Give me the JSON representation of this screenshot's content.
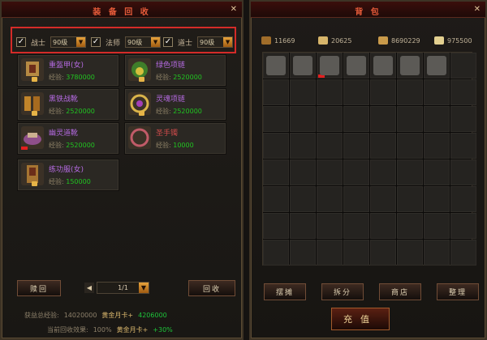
{
  "left_panel": {
    "title": "装 备 回 收",
    "close": "✕",
    "filters": [
      {
        "label": "战士",
        "level": "90级",
        "checked": "✓"
      },
      {
        "label": "法师",
        "level": "90级",
        "checked": "✓"
      },
      {
        "label": "道士",
        "level": "90级",
        "checked": "✓"
      }
    ],
    "exp_label": "经验:",
    "items": [
      {
        "name": "重盔甲(女)",
        "exp": "3780000",
        "name_color": "#b46ae0"
      },
      {
        "name": "绿色项链",
        "exp": "2520000",
        "name_color": "#b46ae0"
      },
      {
        "name": "黑铁战靴",
        "exp": "2520000",
        "name_color": "#b46ae0"
      },
      {
        "name": "灵魂项链",
        "exp": "2520000",
        "name_color": "#b46ae0"
      },
      {
        "name": "幽灵道靴",
        "exp": "2520000",
        "name_color": "#b46ae0"
      },
      {
        "name": "圣手镯",
        "exp": "10000",
        "name_color": "#d04b4b"
      },
      {
        "name": "练功服(女)",
        "exp": "150000",
        "name_color": "#b46ae0"
      }
    ],
    "buttons": {
      "redeem": "赎回",
      "recycle": "回收"
    },
    "pager": {
      "current": "1/1",
      "prev": "◀",
      "next": "▼"
    },
    "summary": {
      "total_exp_label": "获益总经验:",
      "total_exp": "14020000",
      "card_label": "黄金月卡+",
      "card_value": "4206000",
      "efficiency_label": "当前回收效果:",
      "efficiency": "100%",
      "card_pct": "+30%"
    }
  },
  "right_panel": {
    "title": "背 包",
    "close": "✕",
    "resources": [
      {
        "value": "11669",
        "color": "#a06d2a"
      },
      {
        "value": "20625",
        "color": "#d7b56a"
      },
      {
        "value": "8690229",
        "color": "#c99a4a"
      },
      {
        "value": "975500",
        "color": "#e3d090"
      }
    ],
    "buttons": [
      "摆摊",
      "拆分",
      "商店",
      "整理"
    ],
    "recharge": "充值"
  }
}
